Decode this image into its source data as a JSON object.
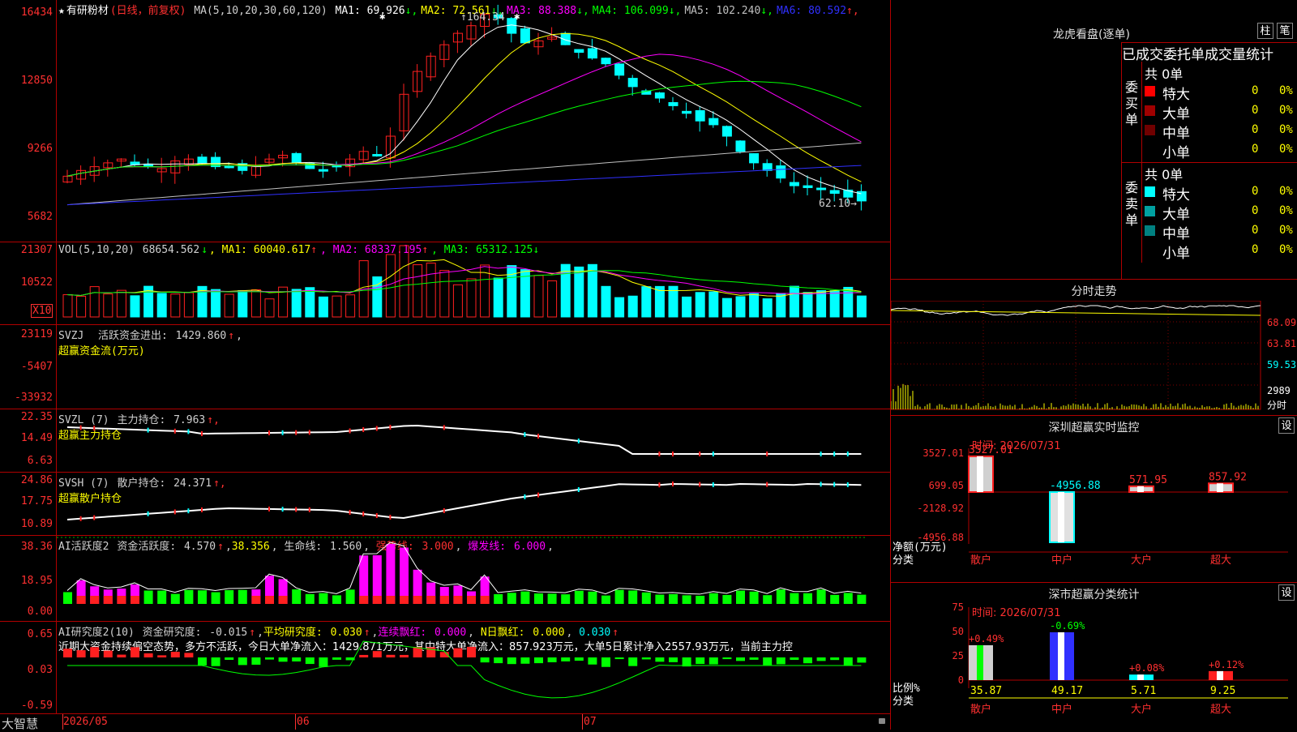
{
  "stock": {
    "star": "★",
    "name": "有研粉材",
    "period": "(日线，前复权)"
  },
  "main": {
    "ma_label": "MA(5,10,20,30,60,120)",
    "ma": [
      {
        "label": "MA1:",
        "value": "69.926",
        "arrow": "↓",
        "color": "#ffffff"
      },
      {
        "label": "MA2:",
        "value": "72.561",
        "arrow": "↓",
        "color": "#ffff00"
      },
      {
        "label": "MA3:",
        "value": "88.388",
        "arrow": "↓",
        "color": "#ff00ff"
      },
      {
        "label": "MA4:",
        "value": "106.099",
        "arrow": "↓",
        "color": "#00ff00"
      },
      {
        "label": "MA5:",
        "value": "102.240",
        "arrow": "↓",
        "color": "#c0c0c0"
      },
      {
        "label": "MA6:",
        "value": "80.592",
        "arrow": "↑",
        "color": "#3030ff"
      }
    ],
    "y_labels": [
      "16434",
      "12850",
      "9266",
      "5682"
    ],
    "high_label": "164.34",
    "low_label": "62.10",
    "up_color": "#ff2020",
    "down_color": "#00ffff"
  },
  "vol": {
    "name": "VOL(5,10,20)",
    "value": "68654.562",
    "arrow": "↓",
    "ma": [
      {
        "label": "MA1:",
        "value": "60040.617",
        "arrow": "↑",
        "color": "#ffff00"
      },
      {
        "label": "MA2:",
        "value": "68337.195",
        "arrow": "↑",
        "color": "#ff00ff"
      },
      {
        "label": "MA3:",
        "value": "65312.125",
        "arrow": "↓",
        "color": "#00ff00"
      }
    ],
    "y_labels": [
      "21307",
      "10522"
    ],
    "unit": "X10"
  },
  "svzj": {
    "name": "SVZJ",
    "label": "活跃资金进出:",
    "value": "1429.860",
    "arrow": "↑",
    "subtitle": "超赢资金流(万元)",
    "y_labels": [
      "23119",
      "-5407",
      "-33932"
    ]
  },
  "svzl": {
    "name": "SVZL (7)",
    "label": "主力持仓:",
    "value": "7.963",
    "arrow": "↑,",
    "subtitle": "超赢主力持仓",
    "y_labels": [
      "22.35",
      "14.49",
      "6.63"
    ]
  },
  "svsh": {
    "name": "SVSH (7)",
    "label": "散户持仓:",
    "value": "24.371",
    "arrow": "↑,",
    "subtitle": "超赢散户持仓",
    "y_labels": [
      "24.86",
      "17.75",
      "10.89"
    ]
  },
  "ai_active": {
    "name": "AI活跃度2",
    "label": "资金活跃度:",
    "value": "4.570",
    "arrow": "↑",
    "v2": "38.356",
    "life_label": "生命线:",
    "life": "1.560",
    "strong_label": "强势线:",
    "strong": "3.000",
    "burst_label": "爆发线:",
    "burst": "6.000",
    "y_labels": [
      "38.36",
      "18.95",
      "0.00"
    ]
  },
  "ai_research": {
    "name": "AI研究度2(10)",
    "label": "资金研究度:",
    "value": "-0.015",
    "arrow": "↑",
    "avg_label": "平均研究度:",
    "avg": "0.030",
    "arrow2": "↑",
    "cont_label": "连续飘红:",
    "cont": "0.000",
    "n_label": "N日飘红:",
    "n": "0.000",
    "extra": "0.030",
    "arrow3": "↑",
    "summary": "近期大资金持续偏空态势，多方不活跃，今日大单净流入：1429.871万元，其中特大单净流入：857.923万元，大单5日累计净入2557.93万元，当前主力控",
    "y_labels": [
      "0.65",
      "0.03",
      "-0.59"
    ]
  },
  "xaxis": {
    "brand": "大智慧",
    "labels": [
      "2026/05",
      "06",
      "07"
    ]
  },
  "right": {
    "dragon_title": "龙虎看盘(逐单)",
    "btn1": "柱",
    "btn2": "笔",
    "stat_title": "已成交委托单成交量统计",
    "buy": {
      "side": "委买单",
      "total": "共 0单",
      "rows": [
        {
          "name": "特大",
          "qty": "0",
          "pct": "0%",
          "color": "#ff0000"
        },
        {
          "name": "大单",
          "qty": "0",
          "pct": "0%",
          "color": "#a00000"
        },
        {
          "name": "中单",
          "qty": "0",
          "pct": "0%",
          "color": "#700000"
        },
        {
          "name": "小单",
          "qty": "0",
          "pct": "0%",
          "color": "#000000"
        }
      ]
    },
    "sell": {
      "side": "委卖单",
      "total": "共 0单",
      "rows": [
        {
          "name": "特大",
          "qty": "0",
          "pct": "0%",
          "color": "#00ffff"
        },
        {
          "name": "大单",
          "qty": "0",
          "pct": "0%",
          "color": "#00a0a0"
        },
        {
          "name": "中单",
          "qty": "0",
          "pct": "0%",
          "color": "#008080"
        },
        {
          "name": "小单",
          "qty": "0",
          "pct": "0%",
          "color": "#000000"
        }
      ]
    },
    "minute": {
      "title": "分时走势",
      "y": [
        "68.09",
        "63.81",
        "59.53"
      ],
      "vol": "2989",
      "vol_unit": "分时"
    },
    "sz_monitor": {
      "title": "深圳超赢实时监控",
      "btn": "设",
      "time_label": "时间:",
      "time": "2026/07/31",
      "y": [
        "3527.01",
        "699.05",
        "-2128.92",
        "-4956.88"
      ],
      "axis_label": "净额(万元)",
      "axis_label2": "分类",
      "cats": [
        "散户",
        "中户",
        "大户",
        "超大"
      ],
      "values": [
        3527.01,
        -4956.88,
        571.95,
        857.92
      ],
      "value_labels": [
        "3527.01",
        "-4956.88",
        "571.95",
        "857.92"
      ]
    },
    "sz_class": {
      "title": "深市超赢分类统计",
      "btn": "设",
      "time_label": "时间:",
      "time": "2026/07/31",
      "y": [
        "75",
        "50",
        "25",
        "0"
      ],
      "axis_label": "比例%",
      "axis_label2": "分类",
      "cats": [
        "散户",
        "中户",
        "大户",
        "超大"
      ],
      "values": [
        35.87,
        49.17,
        5.71,
        9.25
      ],
      "changes": [
        "+0.49%",
        "-0.69%",
        "+0.08%",
        "+0.12%"
      ]
    }
  }
}
